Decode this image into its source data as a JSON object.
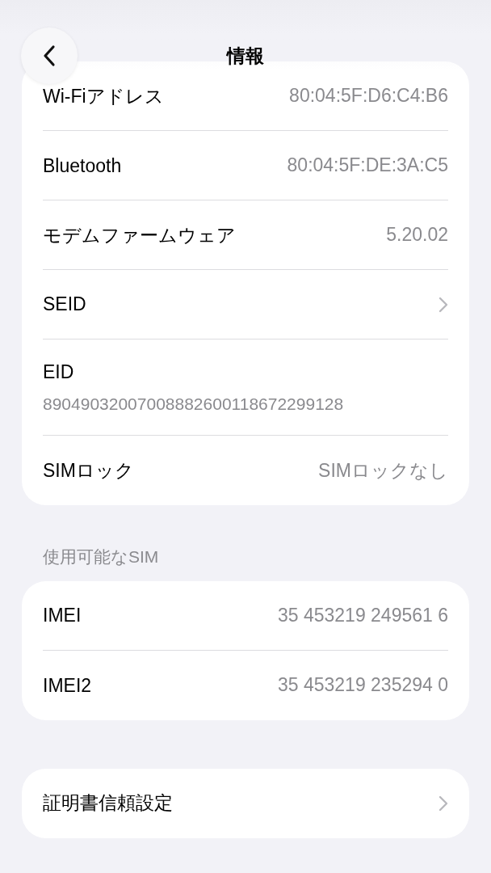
{
  "nav": {
    "title": "情報"
  },
  "groups": [
    {
      "rows": [
        {
          "kind": "value",
          "label": "Wi-Fiアドレス",
          "value": "80:04:5F:D6:C4:B6"
        },
        {
          "kind": "value",
          "label": "Bluetooth",
          "value": "80:04:5F:DE:3A:C5"
        },
        {
          "kind": "value",
          "label": "モデムファームウェア",
          "value": "5.20.02"
        },
        {
          "kind": "link",
          "label": "SEID"
        },
        {
          "kind": "stacked",
          "label": "EID",
          "value": "89049032007008882600118672299128"
        },
        {
          "kind": "value",
          "label": "SIMロック",
          "value": "SIMロックなし"
        }
      ]
    },
    {
      "header": "使用可能なSIM",
      "rows": [
        {
          "kind": "value",
          "label": "IMEI",
          "value": "35 453219 249561 6"
        },
        {
          "kind": "value",
          "label": "IMEI2",
          "value": "35 453219 235294 0"
        }
      ]
    },
    {
      "rows": [
        {
          "kind": "link",
          "label": "証明書信頼設定"
        }
      ]
    }
  ]
}
